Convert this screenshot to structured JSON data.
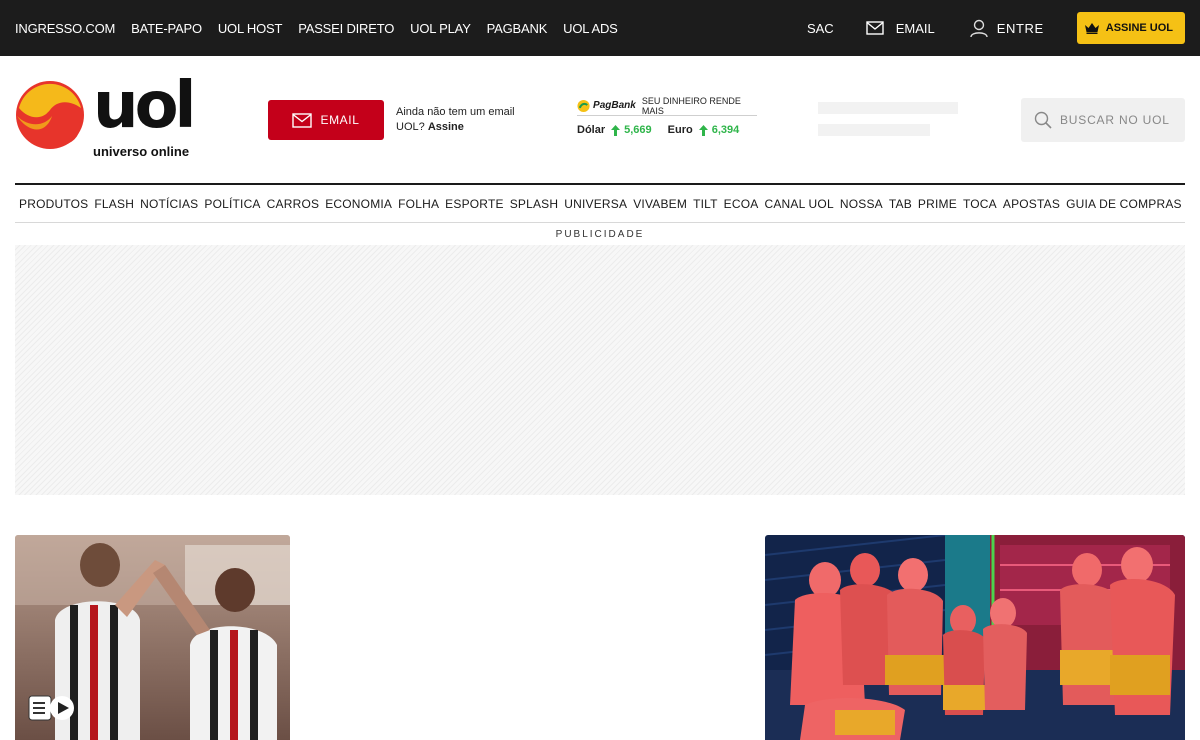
{
  "topbar": {
    "links": [
      "INGRESSO.COM",
      "BATE-PAPO",
      "UOL HOST",
      "PASSEI DIRETO",
      "UOL PLAY",
      "PAGBANK",
      "UOL ADS"
    ],
    "sac": "SAC",
    "email": "EMAIL",
    "login": "ENTRE",
    "subscribe": "ASSINE UOL"
  },
  "header": {
    "logo_word": "uol",
    "logo_tagline": "universo online",
    "email_button": "EMAIL",
    "email_hint_prefix": "Ainda não tem um email UOL?",
    "email_hint_link": "Assine",
    "pagbank": {
      "brand": "PagBank",
      "tagline": "SEU DINHEIRO RENDE MAIS",
      "rates": [
        {
          "label": "Dólar",
          "value": "5,669",
          "trend": "up"
        },
        {
          "label": "Euro",
          "value": "6,394",
          "trend": "up"
        }
      ]
    },
    "search_placeholder": "BUSCAR NO UOL"
  },
  "nav": [
    "PRODUTOS",
    "FLASH",
    "NOTÍCIAS",
    "POLÍTICA",
    "CARROS",
    "ECONOMIA",
    "FOLHA",
    "ESPORTE",
    "SPLASH",
    "UNIVERSA",
    "VIVABEM",
    "TILT",
    "ECOA",
    "CANAL UOL",
    "NOSSA",
    "TAB",
    "PRIME",
    "TOCA",
    "APOSTAS",
    "GUIA DE COMPRAS"
  ],
  "ad_label": "PUBLICIDADE",
  "colors": {
    "topbar_bg": "#1c1c1c",
    "email_red": "#c4001a",
    "subscribe_yellow": "#f5c115",
    "rate_green": "#2fb54a"
  },
  "icons": {
    "topbar_email": "envelope-icon",
    "topbar_login": "user-icon",
    "subscribe": "crown-icon",
    "search": "search-icon",
    "rate_trend": "arrow-up-icon",
    "video": "video-play-icon"
  }
}
